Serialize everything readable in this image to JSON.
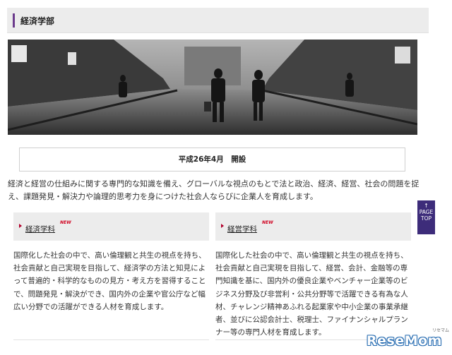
{
  "header": {
    "title": "経済学部"
  },
  "hero": {
    "alt": "経済学部 campus photo"
  },
  "opening": {
    "text": "平成26年4月　開設"
  },
  "intro": {
    "text": "経済と経営の仕組みに関する専門的な知識を備え、グローバルな視点のもとで法と政治、経済、経営、社会の問題を捉え、課題発見・解決力や論理的思考力を身につけた社会人ならびに企業人を育成します。"
  },
  "departments": [
    {
      "name": "経済学科",
      "badge": "NEW",
      "description": "国際化した社会の中で、高い倫理観と共生の視点を持ち、社会貢献と自己実現を目指して、経済学の方法と知見によって普遍的・科学的なものの見方・考え方を習得することで、問題発見・解決ができ、国内外の企業や官公庁など幅広い分野での活躍ができる人材を育成します。"
    },
    {
      "name": "経営学科",
      "badge": "NEW",
      "description": "国際化した社会の中で、高い倫理観と共生の視点を持ち、社会貢献と自己実現を目指して、経営、会計、金融等の専門知識を基に、国内外の優良企業やベンチャー企業等のビジネス分野及び非営利・公共分野等で活躍できる有為な人材、チャレンジ精神あふれる起業家や中小企業の事業承継者、並びに公認会計士、税理士、ファイナンシャルプランナー等の専門人材を育成します。"
    }
  ],
  "pagetop": {
    "arrow": "↑",
    "line1": "PAGE",
    "line2": "TOP"
  },
  "logo": {
    "text": "ReseMom",
    "sub": "リセマム"
  }
}
